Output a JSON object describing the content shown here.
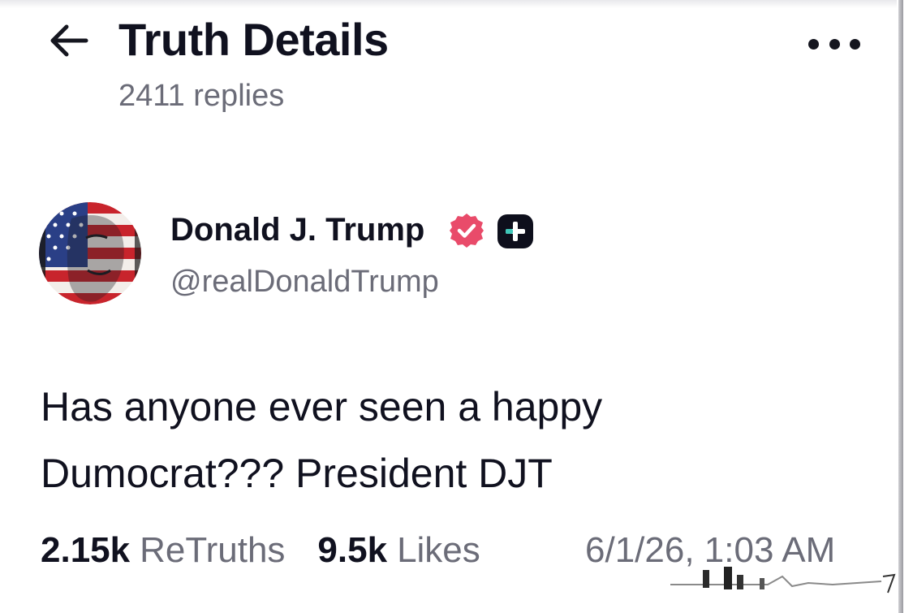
{
  "header": {
    "back_icon": "arrow-left-icon",
    "title": "Truth Details",
    "reply_count": "2411 replies",
    "more_icon": "more-horizontal-icon"
  },
  "author": {
    "display_name": "Donald J. Trump",
    "handle": "@realDonaldTrump",
    "verified_icon": "verified-badge-icon",
    "verified_color": "#e94b6a",
    "plus_icon": "plus-badge-icon"
  },
  "post": {
    "lines": [
      "Has anyone ever seen a happy",
      "Dumocrat??? President DJT"
    ]
  },
  "stats": {
    "retruths_count": "2.15k",
    "retruths_label": "ReTruths",
    "likes_count": "9.5k",
    "likes_label": "Likes",
    "timestamp": "6/1/26, 1:03 AM"
  },
  "colors": {
    "text_primary": "#10111f",
    "text_secondary": "#6b6c78",
    "background": "#ffffff"
  }
}
